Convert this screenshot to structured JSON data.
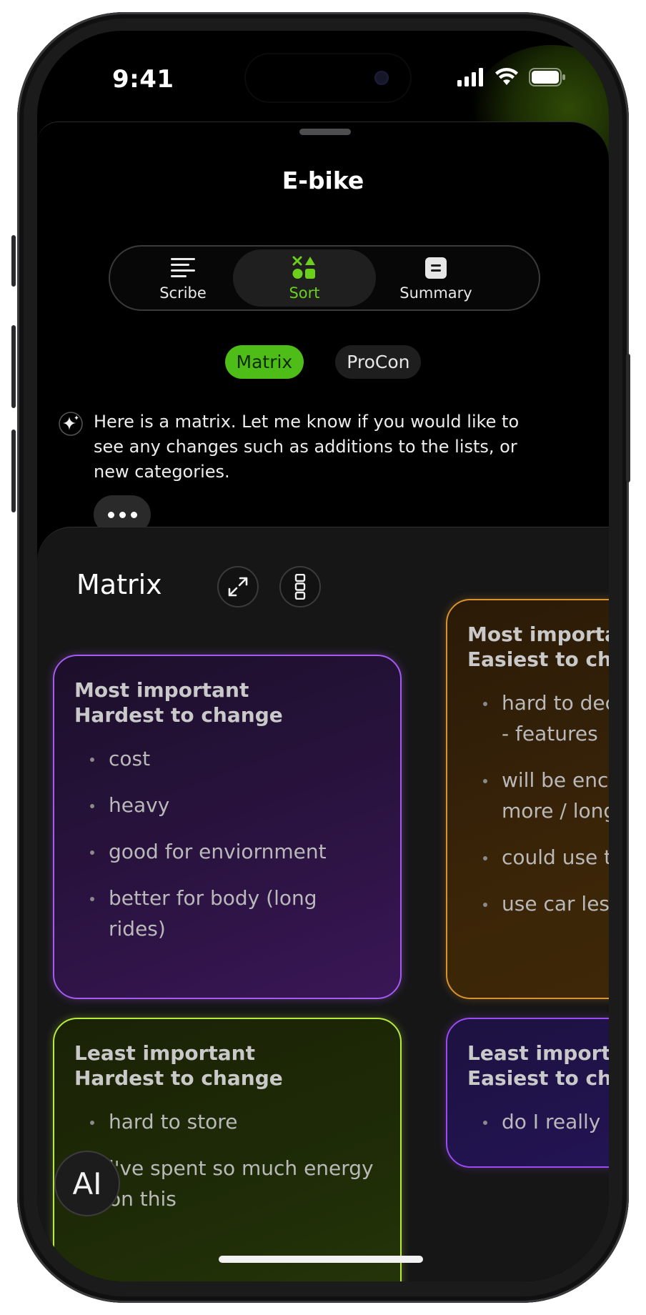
{
  "status": {
    "time": "9:41"
  },
  "header": {
    "title": "E-bike"
  },
  "tabs": [
    {
      "label": "Scribe",
      "icon": "lines-icon"
    },
    {
      "label": "Sort",
      "icon": "shapes-icon",
      "active": true
    },
    {
      "label": "Summary",
      "icon": "document-icon"
    }
  ],
  "chips": [
    {
      "label": "Matrix",
      "active": true
    },
    {
      "label": "ProCon",
      "active": false
    }
  ],
  "ai_message": {
    "text": "Here is a matrix. Let me know if you would like to see any changes such as additions to the lists, or new categories."
  },
  "matrix": {
    "title": "Matrix",
    "cards": [
      {
        "title": "Most important\nHardest to change",
        "items": [
          "cost",
          "heavy",
          "good for enviornment",
          "better for body (long rides)"
        ]
      },
      {
        "title": "Most important\nEasiest to change",
        "items": [
          "hard to decide what I need - features",
          "will be encouraged to bike more / longer distances",
          "could use to commute",
          "use car less"
        ]
      },
      {
        "title": "Least important\nHardest to change",
        "items": [
          "hard to store",
          "i've spent so much energy on this"
        ]
      },
      {
        "title": "Least important\nEasiest to change",
        "items": [
          "do I really Need it"
        ]
      }
    ]
  },
  "fab": {
    "label": "AI"
  },
  "colors": {
    "accent": "#4fbd17",
    "sort_active": "#6ccf1b",
    "purple": "#a55bf2",
    "orange": "#d9932d",
    "lime": "#b7ec3a",
    "violet": "#9b4bf0"
  }
}
